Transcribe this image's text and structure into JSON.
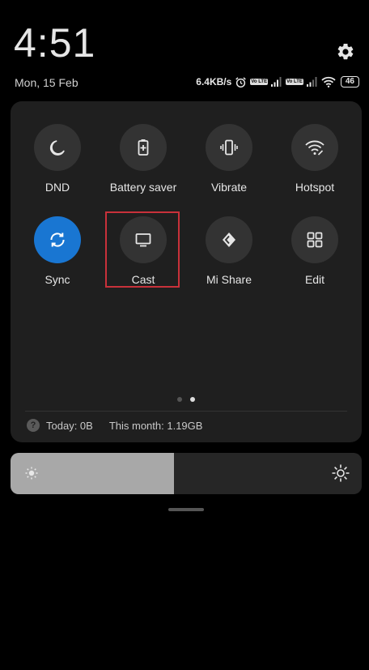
{
  "status": {
    "time": "4:51",
    "date": "Mon, 15 Feb",
    "network_speed": "6.4KB/s",
    "volte_label": "Vo LTE",
    "battery_level": "46"
  },
  "tiles": [
    {
      "id": "dnd",
      "label": "DND",
      "icon": "moon-icon",
      "active": false
    },
    {
      "id": "battery-saver",
      "label": "Battery saver",
      "icon": "battery-plus-icon",
      "active": false
    },
    {
      "id": "vibrate",
      "label": "Vibrate",
      "icon": "vibrate-icon",
      "active": false
    },
    {
      "id": "hotspot",
      "label": "Hotspot",
      "icon": "hotspot-icon",
      "active": false
    },
    {
      "id": "sync",
      "label": "Sync",
      "icon": "sync-icon",
      "active": true
    },
    {
      "id": "cast",
      "label": "Cast",
      "icon": "cast-monitor-icon",
      "active": false,
      "highlighted": true
    },
    {
      "id": "mi-share",
      "label": "Mi Share",
      "icon": "mi-share-icon",
      "active": false
    },
    {
      "id": "edit",
      "label": "Edit",
      "icon": "grid-icon",
      "active": false
    }
  ],
  "pages": {
    "count": 2,
    "current": 2
  },
  "data_usage": {
    "today": "Today: 0B",
    "this_month": "This month: 1.19GB"
  },
  "brightness": {
    "level": 0.465
  },
  "colors": {
    "panel": "#1f1f1f",
    "tile": "#333333",
    "active_tile": "#1976d2",
    "highlight": "#c8313a",
    "brightness_fill": "#a8a8a8"
  }
}
